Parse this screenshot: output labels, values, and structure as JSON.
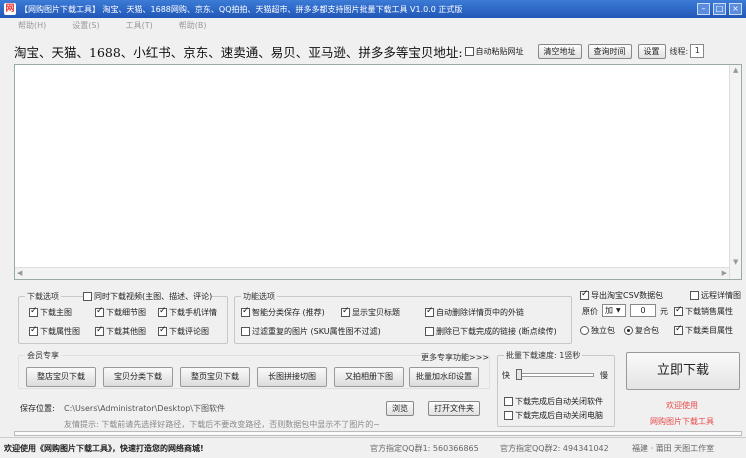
{
  "window": {
    "title": "【网购图片下载工具】 淘宝、天猫、1688网购、京东、QQ拍拍、天猫超市、拼多多都支持图片批量下载工具 V1.0.0 正式版",
    "icon_letter": "网"
  },
  "menu": [
    "帮助(H)",
    "设置(S)",
    "工具(T)",
    "帮助(B)"
  ],
  "url_row": {
    "label": "淘宝、天猫、1688、小红书、京东、速卖通、易贝、亚马逊、拼多多等宝贝地址:",
    "auto_paste_label": "自动粘贴网址",
    "clear_btn": "清空地址",
    "query_btn": "查询时间",
    "settings_btn": "设置",
    "threads_label": "线程:",
    "threads_value": "1"
  },
  "download_options": {
    "title": "下载选项",
    "video_label": "同时下载视频(主图、描述、评论)",
    "items": [
      {
        "label": "下载主图",
        "checked": true
      },
      {
        "label": "下载细节图",
        "checked": true
      },
      {
        "label": "下载手机详情",
        "checked": true
      },
      {
        "label": "下载属性图",
        "checked": true
      },
      {
        "label": "下载其他图",
        "checked": true
      },
      {
        "label": "下载评论图",
        "checked": true
      }
    ]
  },
  "function_options": {
    "title": "功能选项",
    "items": [
      {
        "label": "智能分类保存 (推荐)",
        "checked": true
      },
      {
        "label": "显示宝贝标题",
        "checked": true
      },
      {
        "label": "自动删除详情页中的外链",
        "checked": true
      },
      {
        "label": "过滤重复的图片 (SKU属性图不过滤)",
        "checked": false
      },
      {
        "label": "删除已下载完成的链接 (断点续传)",
        "checked": false
      }
    ]
  },
  "right_options": {
    "export_label": "导出淘宝CSV数据包",
    "detail_label": "远程详情图",
    "price_label": "原价",
    "price_op": "加",
    "price_value": "0",
    "price_unit": "元",
    "sales_attr_label": "下载销售属性",
    "single_label": "独立包",
    "combined_label": "复合包",
    "category_attr_label": "下载类目属性"
  },
  "member": {
    "title": "会员专享",
    "more_label": "更多专享功能>>>",
    "buttons": [
      "整店宝贝下载",
      "宝贝分类下载",
      "整页宝贝下载",
      "长图拼接切图",
      "又拍相册下图",
      "批量加水印设置"
    ]
  },
  "speed": {
    "title": "批量下载速度: 1竖秒",
    "fast": "快",
    "slow": "慢",
    "close_software": "下载完成后自动关闭软件",
    "shutdown": "下载完成后自动关闭电脑"
  },
  "download_now": "立即下载",
  "welcome_link": "欢迎使用",
  "brand_link": "网购图片下载工具",
  "save": {
    "label": "保存位置:",
    "path": "C:\\Users\\Administrator\\Desktop\\下图软件",
    "browse": "浏览",
    "open_folder": "打开文件夹",
    "tip": "友情提示: 下载前请先选择好路径，下载后不要改变路径，否则数据包中显示不了图片的~"
  },
  "status": {
    "welcome": "欢迎使用《网购图片下载工具》，快速打造您的网络商城!",
    "qq1": "官方指定QQ群1: 560366865",
    "qq2": "官方指定QQ群2: 494341042",
    "location": "福建 · 莆田 天图工作室"
  },
  "colors": {
    "titlebar": "#2f6cc9",
    "link_red": "#e84a4a"
  }
}
